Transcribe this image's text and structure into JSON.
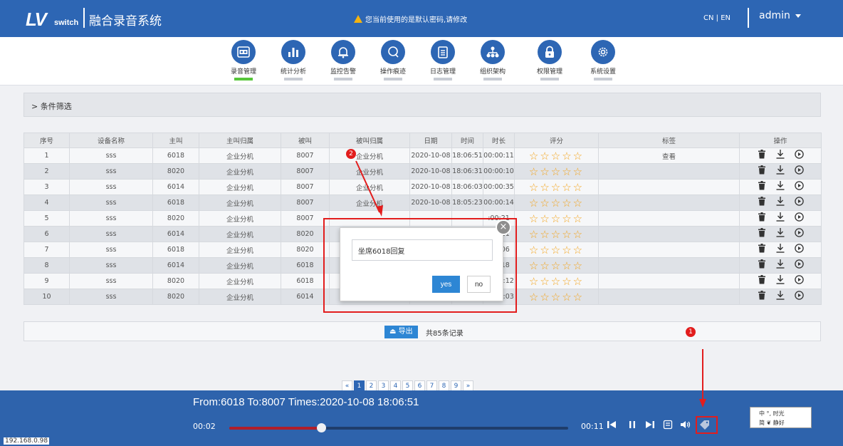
{
  "header": {
    "logo_text": "LV",
    "logo_sub": "switch",
    "app_title": "融合录音系统",
    "warning": "您当前使用的是默认密码,请修改",
    "lang": "CN | EN",
    "user": "admin"
  },
  "nav": [
    {
      "label": "录音管理",
      "icon": "recorder-icon"
    },
    {
      "label": "统计分析",
      "icon": "bar-chart-icon"
    },
    {
      "label": "监控告警",
      "icon": "bell-icon"
    },
    {
      "label": "操作痕迹",
      "icon": "search-icon"
    },
    {
      "label": "日志管理",
      "icon": "log-icon"
    },
    {
      "label": "组织架构",
      "icon": "org-icon"
    },
    {
      "label": "权限管理",
      "icon": "lock-icon"
    },
    {
      "label": "系统设置",
      "icon": "gear-icon"
    }
  ],
  "filter": {
    "label": "> 条件筛选"
  },
  "table": {
    "headers": [
      "序号",
      "设备名称",
      "主叫",
      "主叫归属",
      "被叫",
      "被叫归属",
      "日期",
      "时间",
      "时长",
      "评分",
      "标签",
      "操作"
    ],
    "rows": [
      {
        "no": "1",
        "device": "sss",
        "caller": "6018",
        "caller_loc": "企业分机",
        "callee": "8007",
        "callee_loc": "企业分机",
        "date": "2020-10-08",
        "time": "18:06:51",
        "duration": "00:00:11",
        "tag": "查看"
      },
      {
        "no": "2",
        "device": "sss",
        "caller": "8020",
        "caller_loc": "企业分机",
        "callee": "8007",
        "callee_loc": "企业分机",
        "date": "2020-10-08",
        "time": "18:06:31",
        "duration": "00:00:10",
        "tag": ""
      },
      {
        "no": "3",
        "device": "sss",
        "caller": "6014",
        "caller_loc": "企业分机",
        "callee": "8007",
        "callee_loc": "企业分机",
        "date": "2020-10-08",
        "time": "18:06:03",
        "duration": "00:00:35",
        "tag": ""
      },
      {
        "no": "4",
        "device": "sss",
        "caller": "6018",
        "caller_loc": "企业分机",
        "callee": "8007",
        "callee_loc": "企业分机",
        "date": "2020-10-08",
        "time": "18:05:23",
        "duration": "00:00:14",
        "tag": ""
      },
      {
        "no": "5",
        "device": "sss",
        "caller": "8020",
        "caller_loc": "企业分机",
        "callee": "8007",
        "callee_loc": "",
        "date": "",
        "time": "",
        "duration": ":00:21",
        "tag": ""
      },
      {
        "no": "6",
        "device": "sss",
        "caller": "6014",
        "caller_loc": "企业分机",
        "callee": "8020",
        "callee_loc": "",
        "date": "",
        "time": "",
        "duration": ":00:11",
        "tag": ""
      },
      {
        "no": "7",
        "device": "sss",
        "caller": "6018",
        "caller_loc": "企业分机",
        "callee": "8020",
        "callee_loc": "",
        "date": "",
        "time": "",
        "duration": ":00:06",
        "tag": ""
      },
      {
        "no": "8",
        "device": "sss",
        "caller": "6014",
        "caller_loc": "企业分机",
        "callee": "6018",
        "callee_loc": "",
        "date": "",
        "time": "",
        "duration": ":00:18",
        "tag": ""
      },
      {
        "no": "9",
        "device": "sss",
        "caller": "8020",
        "caller_loc": "企业分机",
        "callee": "6018",
        "callee_loc": "企业分机",
        "date": "2020-10-08",
        "time": "18:03:33",
        "duration": "00:00:12",
        "tag": ""
      },
      {
        "no": "10",
        "device": "sss",
        "caller": "8020",
        "caller_loc": "企业分机",
        "callee": "6014",
        "callee_loc": "企业分机",
        "date": "2020-10-08",
        "time": "18:03:11",
        "duration": "00:00:03",
        "tag": ""
      }
    ]
  },
  "footer": {
    "export_label": "导出",
    "record_count": "共85条记录"
  },
  "pagination": {
    "prev": "«",
    "pages": [
      "1",
      "2",
      "3",
      "4",
      "5",
      "6",
      "7",
      "8",
      "9"
    ],
    "next": "»",
    "current": "1"
  },
  "player": {
    "info": "From:6018 To:8007 Times:2020-10-08 18:06:51",
    "current_time": "00:02",
    "total_time": "00:11",
    "progress": 0.27
  },
  "status": {
    "ip": "192.168.0.98"
  },
  "modal": {
    "input_value": "坐席6018回复",
    "yes_label": "yes",
    "no_label": "no",
    "close": "×"
  },
  "annotations": {
    "badge1": "1",
    "badge2": "2"
  },
  "ime": {
    "line1": "中 °, 时光",
    "line2": "简 ❦ 静好"
  },
  "colors": {
    "primary": "#2d66b4",
    "accent_green": "#57c63a",
    "star": "#f3a41c",
    "highlight": "#e21d1d"
  }
}
